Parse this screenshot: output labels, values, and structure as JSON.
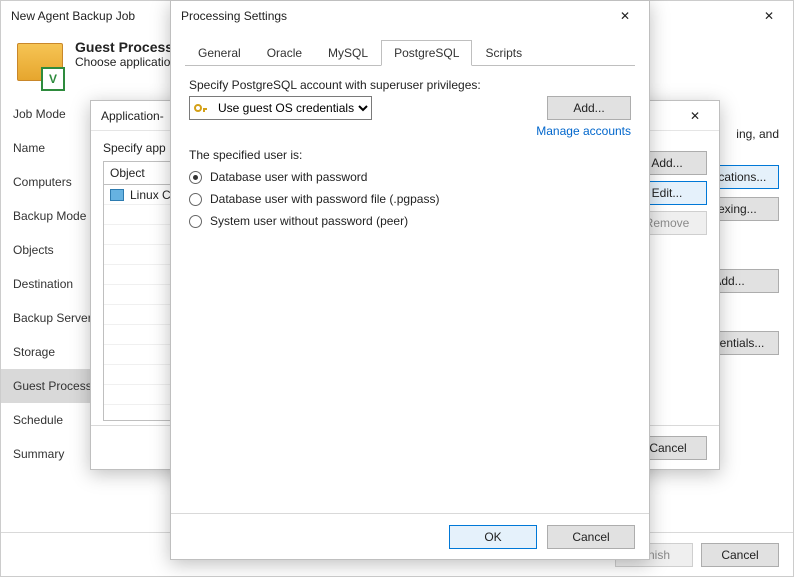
{
  "wizard": {
    "title": "New Agent Backup Job",
    "header_bold": "Guest Processing",
    "header_sub": "Choose application",
    "right_desc_tail": "ing, and",
    "steps": [
      "Job Mode",
      "Name",
      "Computers",
      "Backup Mode",
      "Objects",
      "Destination",
      "Backup Server",
      "Storage",
      "Guest Processing",
      "Schedule",
      "Summary"
    ],
    "active_step": "Guest Processing",
    "right_buttons": [
      "Applications...",
      "Indexing...",
      "Add...",
      "Credentials..."
    ],
    "footer": {
      "finish": "Finish",
      "cancel": "Cancel"
    }
  },
  "middle": {
    "title": "Application-",
    "specify": "Specify app",
    "col": "Object",
    "row1": "Linux C",
    "side": {
      "add": "Add...",
      "edit": "Edit...",
      "remove": "Remove"
    },
    "footer": {
      "cancel": "Cancel"
    }
  },
  "dialog": {
    "title": "Processing Settings",
    "tabs": [
      "General",
      "Oracle",
      "MySQL",
      "PostgreSQL",
      "Scripts"
    ],
    "active_tab": "PostgreSQL",
    "label1": "Specify PostgreSQL account with superuser privileges:",
    "cred_value": "Use guest OS credentials",
    "add": "Add...",
    "manage": "Manage accounts",
    "user_is": "The specified user is:",
    "radios": [
      {
        "label": "Database user with password",
        "sel": true
      },
      {
        "label": "Database user with password file (.pgpass)",
        "sel": false
      },
      {
        "label": "System user without password (peer)",
        "sel": false
      }
    ],
    "ok": "OK",
    "cancel": "Cancel"
  }
}
